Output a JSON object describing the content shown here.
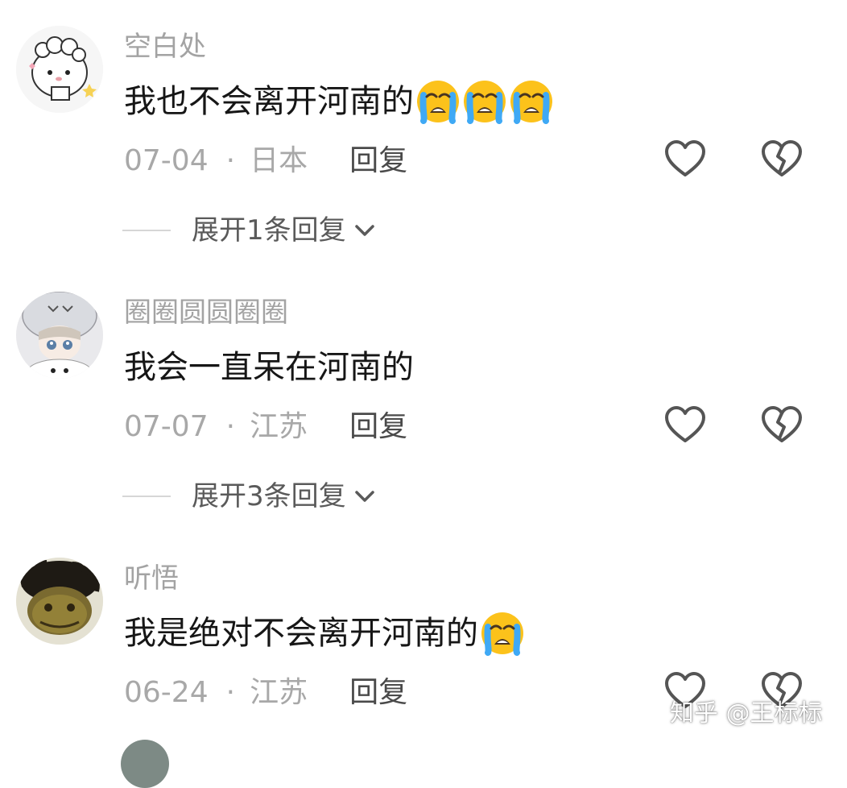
{
  "comments": [
    {
      "username": "空白处",
      "text": "我也不会离开河南的",
      "emojis": [
        "loudly-crying-face",
        "loudly-crying-face",
        "loudly-crying-face"
      ],
      "date": "07-04",
      "location": "日本",
      "reply_label": "回复",
      "expand_label": "展开1条回复"
    },
    {
      "username": "圈圈圆圆圈圈",
      "text": "我会一直呆在河南的",
      "emojis": [],
      "date": "07-07",
      "location": "江苏",
      "reply_label": "回复",
      "expand_label": "展开3条回复"
    },
    {
      "username": "听悟",
      "text": "我是绝对不会离开河南的",
      "emojis": [
        "loudly-crying-face"
      ],
      "date": "06-24",
      "location": "江苏",
      "reply_label": "回复"
    }
  ],
  "separator": "·",
  "watermark": "知乎 @王标标",
  "colors": {
    "username": "#a3a3a3",
    "text": "#161616",
    "meta": "#a8a8a8",
    "icon": "#555555"
  }
}
